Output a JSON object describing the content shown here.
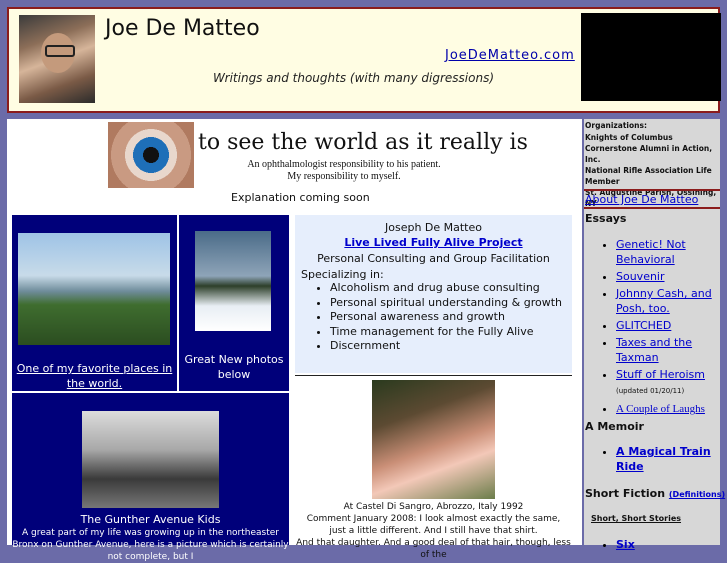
{
  "header": {
    "title": "Joe De Matteo",
    "site_link": "JoeDeMatteo.com",
    "tagline": "Writings and thoughts (with many digressions)"
  },
  "banner": {
    "headline": "to see the world as it really is",
    "sub1": "An ophthalmologist responsibility to his patient.",
    "sub2": "My responsibility to myself."
  },
  "explanation": "Explanation coming soon",
  "favorite": {
    "link": "One of my favorite places in the world."
  },
  "winter": {
    "caption": "Great New photos below"
  },
  "gunther": {
    "title": "The Gunther Avenue Kids",
    "text": "A great part of my life was growing up in the northeaster Bronx on Gunther Avenue, here is a picture which is certainly not complete, but I"
  },
  "joseph": {
    "name": "Joseph De Matteo",
    "project": "Live Lived Fully Alive Project",
    "consulting": "Personal Consulting and Group Facilitation",
    "specializing": "Specializing in:",
    "items": [
      "Alcoholism and drug abuse consulting",
      "Personal spiritual understanding & growth",
      "Personal awareness and growth",
      "Time management for the Fully Alive",
      "Discernment"
    ]
  },
  "castel": {
    "caption": "At Castel Di Sangro, Abrozzo, Italy 1992",
    "comment1": "Comment January 2008: I look almost exactly the same,",
    "comment2": "just a little different. And I still have that shirt.",
    "comment3": "And that daughter.  And a good deal of that hair, though, less of the"
  },
  "sidebar": {
    "org_title": "Organizations:",
    "orgs": [
      "Knights of Columbus",
      "Cornerstone Alumni in Action, Inc.",
      "National Rifle Association Life Member",
      "St. Augustine Parish, Ossining, NY"
    ],
    "about": "About Joe De Matteo",
    "essays_heading": "Essays",
    "essays": [
      "Genetic! Not Behavioral",
      "Souvenir",
      "Johnny Cash, and Posh, too.",
      "GLITCHED",
      "Taxes and the Taxman",
      "Stuff of Heroism"
    ],
    "heroism_note": "(updated 01/20/11)",
    "laughs": "A Couple of Laughs",
    "memoir_heading": "A Memoir",
    "memoir_item": "A Magical Train Ride",
    "fiction_heading": "Short Fiction",
    "fiction_definitions": "(Definitions)",
    "short_short": "Short, Short Stories",
    "fiction_item": "Six"
  },
  "colors": {
    "page_bg": "#6b6ba8",
    "navy": "#00007a",
    "header_bg": "#fffde3",
    "accent_red": "#8b1c1c",
    "link": "#0000cc"
  }
}
